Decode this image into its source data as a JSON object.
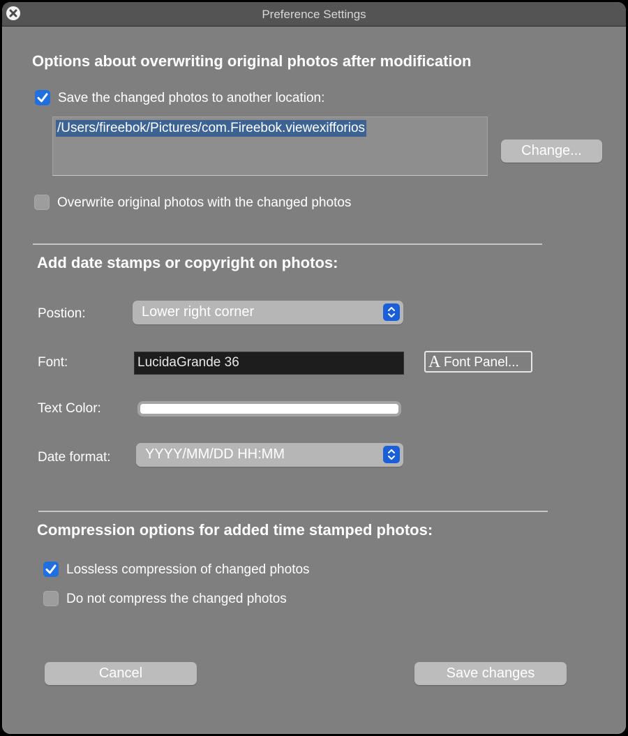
{
  "window": {
    "title": "Preference Settings",
    "close_icon": "close-circle-icon"
  },
  "overwrite_section": {
    "heading": "Options about overwriting original photos after modification",
    "save_elsewhere": {
      "label": "Save the changed photos to another location:",
      "checked": true
    },
    "path_value": "/Users/fireebok/Pictures/com.Fireebok.viewexifforios",
    "change_button": "Change...",
    "overwrite_original": {
      "label": "Overwrite original photos with the changed photos",
      "checked": false
    }
  },
  "stamp_section": {
    "heading": "Add date stamps or copyright on photos:",
    "position": {
      "label": "Postion:",
      "selected": "Lower right corner"
    },
    "font": {
      "label": "Font:",
      "value": "LucidaGrande 36",
      "panel_button_glyph": "A",
      "panel_button": "Font Panel..."
    },
    "text_color": {
      "label": "Text Color:",
      "color": "#ffffff"
    },
    "date_format": {
      "label": "Date format:",
      "selected": "YYYY/MM/DD HH:MM"
    }
  },
  "compression_section": {
    "heading": "Compression options for added time stamped photos:",
    "lossless": {
      "label": "Lossless compression of changed photos",
      "checked": true
    },
    "no_compress": {
      "label": "Do not compress the changed photos",
      "checked": false
    }
  },
  "footer": {
    "cancel": "Cancel",
    "save": "Save changes"
  },
  "colors": {
    "accent": "#1f6fe0",
    "window_bg": "#7f7f7f",
    "titlebar_bg": "#545454",
    "selection": "#3d6393"
  }
}
